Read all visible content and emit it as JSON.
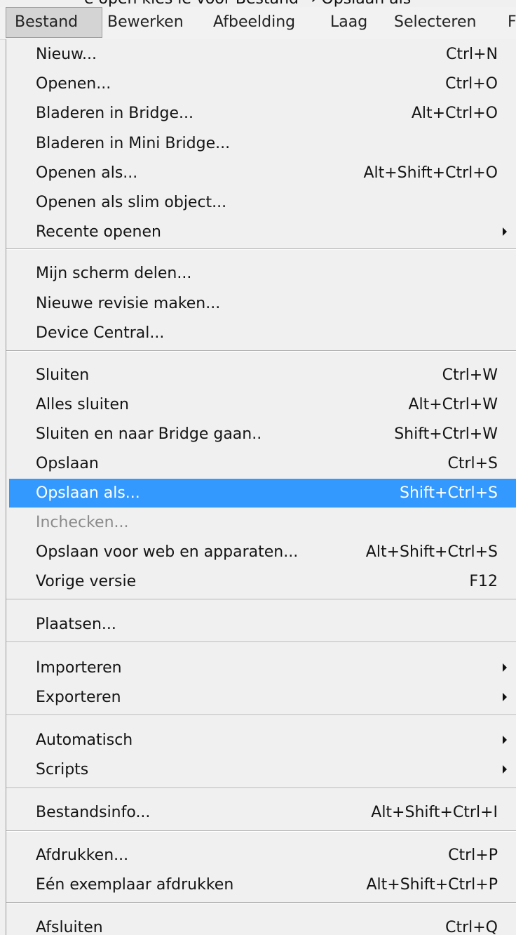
{
  "clipped_text": "e open kies ie voor Bestand → Opslaan als",
  "menubar": {
    "items": [
      "Bestand",
      "Bewerken",
      "Afbeelding",
      "Laag",
      "Selecteren",
      "F"
    ],
    "active": "Bestand"
  },
  "menu": {
    "items": [
      {
        "label": "Nieuw...",
        "shortcut": "Ctrl+N"
      },
      {
        "label": "Openen...",
        "shortcut": "Ctrl+O"
      },
      {
        "label": "Bladeren in Bridge...",
        "shortcut": "Alt+Ctrl+O"
      },
      {
        "label": "Bladeren in Mini Bridge...",
        "shortcut": ""
      },
      {
        "label": "Openen als...",
        "shortcut": "Alt+Shift+Ctrl+O"
      },
      {
        "label": "Openen als slim object...",
        "shortcut": ""
      },
      {
        "label": "Recente openen",
        "shortcut": ""
      },
      {
        "label": "Mijn scherm delen...",
        "shortcut": ""
      },
      {
        "label": "Nieuwe revisie maken...",
        "shortcut": ""
      },
      {
        "label": "Device Central...",
        "shortcut": ""
      },
      {
        "label": "Sluiten",
        "shortcut": "Ctrl+W"
      },
      {
        "label": "Alles sluiten",
        "shortcut": "Alt+Ctrl+W"
      },
      {
        "label": "Sluiten en naar Bridge gaan..",
        "shortcut": "Shift+Ctrl+W"
      },
      {
        "label": "Opslaan",
        "shortcut": "Ctrl+S"
      },
      {
        "label": "Opslaan als...",
        "shortcut": "Shift+Ctrl+S"
      },
      {
        "label": "Inchecken...",
        "shortcut": ""
      },
      {
        "label": "Opslaan voor web en apparaten...",
        "shortcut": "Alt+Shift+Ctrl+S"
      },
      {
        "label": "Vorige versie",
        "shortcut": "F12"
      },
      {
        "label": "Plaatsen...",
        "shortcut": ""
      },
      {
        "label": "Importeren",
        "shortcut": ""
      },
      {
        "label": "Exporteren",
        "shortcut": ""
      },
      {
        "label": "Automatisch",
        "shortcut": ""
      },
      {
        "label": "Scripts",
        "shortcut": ""
      },
      {
        "label": "Bestandsinfo...",
        "shortcut": "Alt+Shift+Ctrl+I"
      },
      {
        "label": "Afdrukken...",
        "shortcut": "Ctrl+P"
      },
      {
        "label": "Eén exemplaar afdrukken",
        "shortcut": "Alt+Shift+Ctrl+P"
      },
      {
        "label": "Afsluiten",
        "shortcut": "Ctrl+Q"
      }
    ]
  },
  "icons": {
    "submenu_arrow": "chevron-right-icon"
  },
  "colors": {
    "highlight": "#3399ff",
    "disabled_text": "#8a8a8a",
    "menu_background": "#f0f0f0"
  }
}
